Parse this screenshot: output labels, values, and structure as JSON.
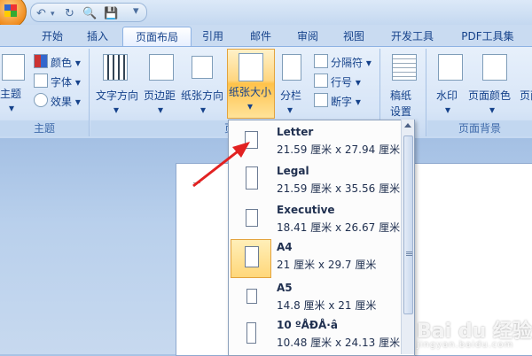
{
  "quick_access": {
    "icons": [
      "office-orb",
      "undo-icon",
      "redo-icon",
      "print-preview-icon",
      "save-icon",
      "customize-icon"
    ]
  },
  "tabs": [
    "开始",
    "插入",
    "页面布局",
    "引用",
    "邮件",
    "审阅",
    "视图",
    "开发工具",
    "PDF工具集"
  ],
  "active_tab": "页面布局",
  "ribbon": {
    "theme_group": {
      "label": "主题",
      "theme_button": "主题",
      "colors": "颜色",
      "fonts": "字体",
      "effects": "效果"
    },
    "page_setup_group": {
      "label": "页面",
      "text_direction": "文字方向",
      "margins": "页边距",
      "orientation": "纸张方向",
      "size": "纸张大小",
      "columns": "分栏",
      "breaks": "分隔符",
      "line_numbers": "行号",
      "hyphenation": "断字"
    },
    "draft_group": {
      "manuscript": "稿纸",
      "setup": "设置"
    },
    "background_group": {
      "label": "页面背景",
      "watermark": "水印",
      "page_color": "页面颜色",
      "page_borders": "页面边"
    }
  },
  "paper_sizes": [
    {
      "name": "Letter",
      "size": "21.59 厘米 x 27.94 厘米"
    },
    {
      "name": "Legal",
      "size": "21.59 厘米 x 35.56 厘米"
    },
    {
      "name": "Executive",
      "size": "18.41 厘米 x 26.67 厘米"
    },
    {
      "name": "A4",
      "size": "21 厘米 x 29.7 厘米"
    },
    {
      "name": "A5",
      "size": "14.8 厘米 x 21 厘米"
    },
    {
      "name": "10 ºÅĐÅ·â",
      "size": "10.48 厘米 x 24.13 厘米"
    }
  ],
  "selected_paper": "A4",
  "watermark": {
    "text": "Bai du 经验",
    "sub": "jingyan.baidu.com"
  },
  "colors": {
    "accent": "#e22222",
    "selection": "#ffd77a"
  }
}
